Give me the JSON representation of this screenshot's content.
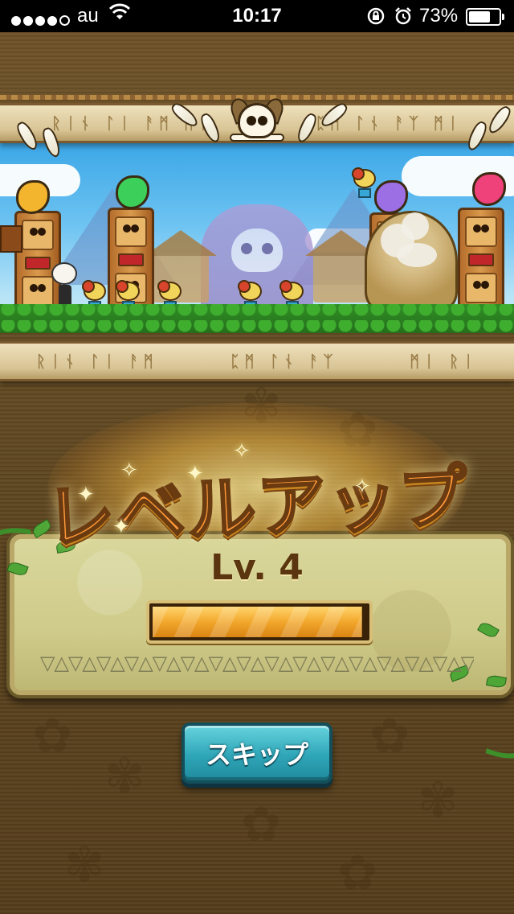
{
  "status_bar": {
    "carrier": "au",
    "time": "10:17",
    "battery_percent": "73%",
    "battery_level": 0.73,
    "signal_bars_filled": 4,
    "signal_bars_total": 5,
    "icons": [
      "signal-dots-icon",
      "wifi-icon",
      "rotation-lock-icon",
      "alarm-icon",
      "battery-icon"
    ]
  },
  "levelup": {
    "title": "レベルアップ",
    "level_label": "Lv. 4",
    "exp_progress": 0.98
  },
  "buttons": {
    "skip_label": "スキップ"
  },
  "colors": {
    "background": "#5c441f",
    "title_orange": "#ff9a3a",
    "exp_bar": "#f2a72c",
    "skip_button": "#2fa6b8",
    "panel": "#cfcb8a"
  }
}
